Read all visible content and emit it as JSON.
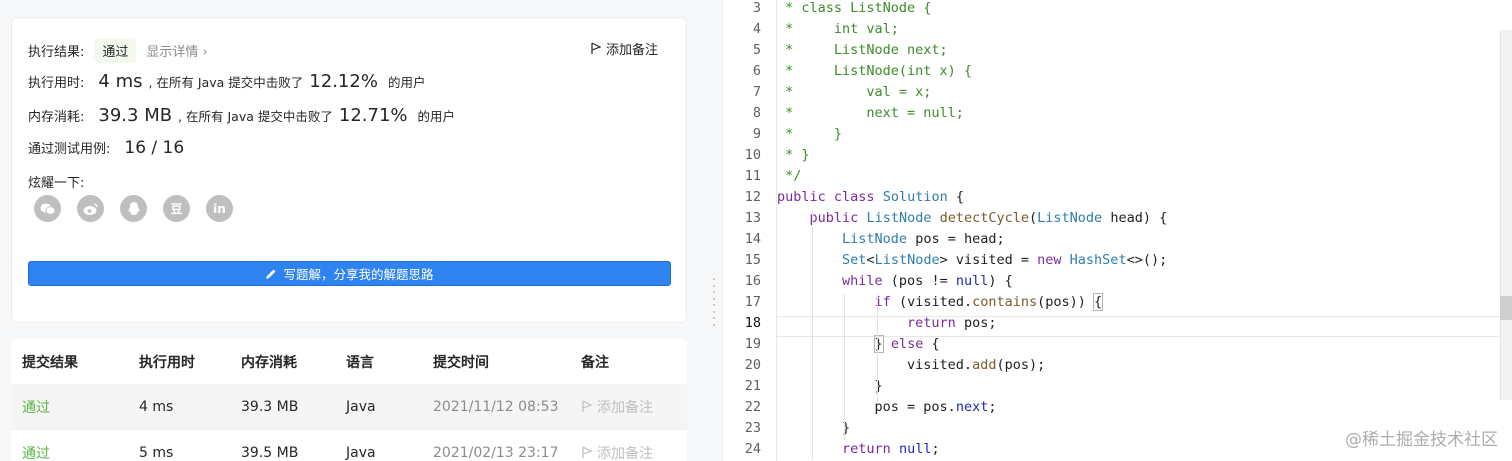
{
  "result": {
    "label": "执行结果:",
    "status": "通过",
    "details": "显示详情 ›",
    "add_note": "添加备注"
  },
  "runtime": {
    "label": "执行用时:",
    "value": "4 ms",
    "middle": ", 在所有 Java 提交中击败了",
    "percent": "12.12%",
    "suffix": "的用户"
  },
  "memory": {
    "label": "内存消耗:",
    "value": "39.3 MB",
    "middle": ", 在所有 Java 提交中击败了",
    "percent": "12.71%",
    "suffix": "的用户"
  },
  "tests": {
    "label": "通过测试用例:",
    "value": "16 / 16"
  },
  "share": {
    "label": "炫耀一下:",
    "icons": [
      "wechat-icon",
      "weibo-icon",
      "qq-icon",
      "douban-icon",
      "linkedin-icon"
    ],
    "douban_glyph": "豆",
    "linkedin_glyph": "in"
  },
  "write_button": "写题解，分享我的解题思路",
  "submissions": {
    "headers": [
      "提交结果",
      "执行用时",
      "内存消耗",
      "语言",
      "提交时间",
      "备注"
    ],
    "rows": [
      {
        "result": "通过",
        "runtime": "4 ms",
        "memory": "39.3 MB",
        "language": "Java",
        "time": "2021/11/12 08:53",
        "note": "添加备注"
      },
      {
        "result": "通过",
        "runtime": "5 ms",
        "memory": "39.5 MB",
        "language": "Java",
        "time": "2021/02/13 23:17",
        "note": "添加备注"
      }
    ]
  },
  "code": {
    "line_numbers": [
      "3",
      "4",
      "5",
      "6",
      "7",
      "8",
      "9",
      "10",
      "11",
      "12",
      "13",
      "14",
      "15",
      "16",
      "17",
      "18",
      "19",
      "20",
      "21",
      "22",
      "23",
      "24"
    ],
    "current_line": "18",
    "lines": [
      " * class ListNode {",
      " *     int val;",
      " *     ListNode next;",
      " *     ListNode(int x) {",
      " *         val = x;",
      " *         next = null;",
      " *     }",
      " * }",
      " */",
      "public class Solution {",
      "    public ListNode detectCycle(ListNode head) {",
      "        ListNode pos = head;",
      "        Set<ListNode> visited = new HashSet<>();",
      "        while (pos != null) {",
      "            if (visited.contains(pos)) {",
      "                return pos;",
      "            } else {",
      "                visited.add(pos);",
      "            }",
      "            pos = pos.next;",
      "        }",
      "        return null;"
    ]
  },
  "watermark": "@稀土掘金技术社区",
  "colors": {
    "accent": "#2f83f0",
    "pass": "#5bb643",
    "comment": "#3c8c28",
    "keyword": "#7a2b99"
  }
}
